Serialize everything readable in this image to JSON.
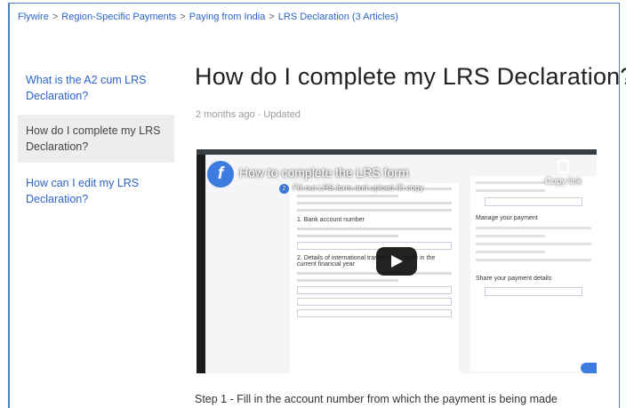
{
  "breadcrumb": {
    "items": [
      "Flywire",
      "Region-Specific Payments",
      "Paying from India",
      "LRS Declaration (3 Articles)"
    ],
    "separator": ">"
  },
  "sidebar": {
    "items": [
      {
        "label": "What is the A2 cum LRS Declaration?",
        "active": false
      },
      {
        "label": "How do I complete my LRS Declaration?",
        "active": true
      },
      {
        "label": "How can I edit my LRS Declaration?",
        "active": false
      }
    ]
  },
  "article": {
    "title": "How do I complete my LRS Declaration?",
    "time": "2 months ago",
    "meta_sep": "·",
    "status": "Updated",
    "step1": "Step 1 - Fill in the account number from which the payment is being made"
  },
  "video": {
    "title": "How to complete the LRS form",
    "copy_label": "Copy link",
    "step_title": "Fill out LRS form and upload ID copy",
    "step_num": "2",
    "section_bank": "1. Bank account number",
    "section_details": "2. Details of international transactions made in the current financial year",
    "panel_manage": "Manage your payment",
    "panel_share": "Share your payment details",
    "logo_glyph": "f"
  },
  "colors": {
    "link": "#2d64c8",
    "accent": "#3c7ce0",
    "active_bg": "#eceded"
  }
}
